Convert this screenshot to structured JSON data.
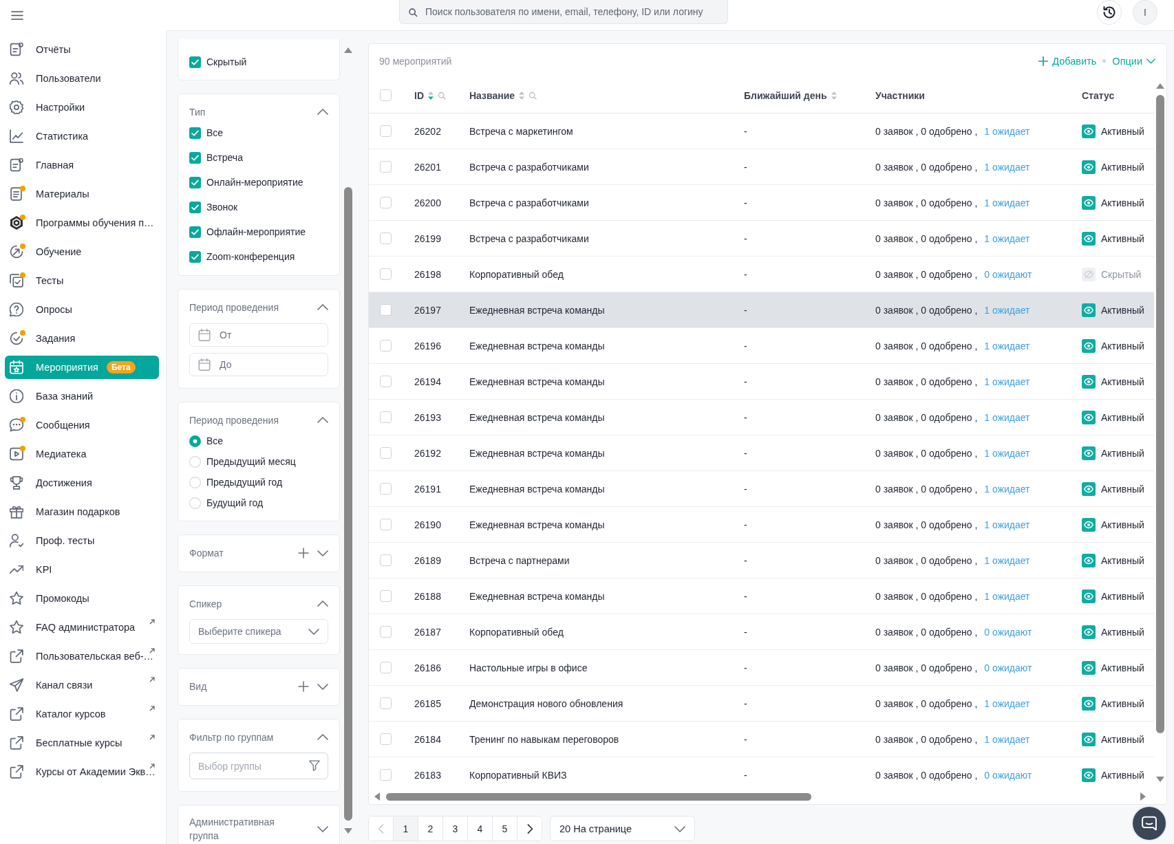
{
  "topbar": {
    "search_placeholder": "Поиск пользователя по имени, email, телефону, ID или логину",
    "avatar": "I"
  },
  "sidebar": {
    "items": [
      {
        "label": "Отчёты",
        "selected": false,
        "notification": false,
        "external": false
      },
      {
        "label": "Пользователи",
        "selected": false,
        "notification": false,
        "external": false
      },
      {
        "label": "Настройки",
        "selected": false,
        "notification": false,
        "external": false
      },
      {
        "label": "Статистика",
        "selected": false,
        "notification": false,
        "external": false
      },
      {
        "label": "Главная",
        "selected": false,
        "notification": false,
        "external": false
      },
      {
        "label": "Материалы",
        "selected": false,
        "notification": true,
        "external": false
      },
      {
        "label": "Программы обучения п…",
        "selected": false,
        "notification": true,
        "external": false
      },
      {
        "label": "Обучение",
        "selected": false,
        "notification": true,
        "external": false
      },
      {
        "label": "Тесты",
        "selected": false,
        "notification": true,
        "external": false
      },
      {
        "label": "Опросы",
        "selected": false,
        "notification": false,
        "external": false
      },
      {
        "label": "Задания",
        "selected": false,
        "notification": true,
        "external": false
      },
      {
        "label": "Мероприятия",
        "selected": true,
        "notification": false,
        "external": false,
        "badge": "Бета"
      },
      {
        "label": "База знаний",
        "selected": false,
        "notification": false,
        "external": false
      },
      {
        "label": "Сообщения",
        "selected": false,
        "notification": true,
        "external": false
      },
      {
        "label": "Медиатека",
        "selected": false,
        "notification": true,
        "external": false
      },
      {
        "label": "Достижения",
        "selected": false,
        "notification": false,
        "external": false
      },
      {
        "label": "Магазин подарков",
        "selected": false,
        "notification": false,
        "external": false
      },
      {
        "label": "Проф. тесты",
        "selected": false,
        "notification": false,
        "external": false
      },
      {
        "label": "KPI",
        "selected": false,
        "notification": false,
        "external": false
      },
      {
        "label": "Промокоды",
        "selected": false,
        "notification": false,
        "external": false
      },
      {
        "label": "FAQ администратора",
        "selected": false,
        "notification": false,
        "external": true
      },
      {
        "label": "Пользовательская веб-…",
        "selected": false,
        "notification": false,
        "external": true
      },
      {
        "label": "Канал связи",
        "selected": false,
        "notification": false,
        "external": true
      },
      {
        "label": "Каталог курсов",
        "selected": false,
        "notification": false,
        "external": true
      },
      {
        "label": "Бесплатные курсы",
        "selected": false,
        "notification": false,
        "external": true
      },
      {
        "label": "Курсы от Академии Экв…",
        "selected": false,
        "notification": false,
        "external": true
      }
    ]
  },
  "filters": {
    "sections": [
      {
        "kind": "checkboxes",
        "items": [
          {
            "label": "Скрытый",
            "checked": true
          }
        ]
      },
      {
        "kind": "checkboxes",
        "title": "Тип",
        "expanded": true,
        "addable": false,
        "items": [
          {
            "label": "Все",
            "checked": true
          },
          {
            "label": "Встреча",
            "checked": true
          },
          {
            "label": "Онлайн-мероприятие",
            "checked": true
          },
          {
            "label": "Звонок",
            "checked": true
          },
          {
            "label": "Офлайн-мероприятие",
            "checked": true
          },
          {
            "label": "Zoom-конференция",
            "checked": true
          }
        ]
      },
      {
        "kind": "dates",
        "title": "Период проведения",
        "expanded": true,
        "addable": false,
        "fields": [
          {
            "placeholder": "От"
          },
          {
            "placeholder": "До"
          }
        ]
      },
      {
        "kind": "radios",
        "title": "Период проведения",
        "expanded": true,
        "addable": false,
        "options": [
          {
            "label": "Все",
            "selected": true
          },
          {
            "label": "Предыдущий месяц",
            "selected": false
          },
          {
            "label": "Предыдущий год",
            "selected": false
          },
          {
            "label": "Будущий год",
            "selected": false
          }
        ]
      },
      {
        "title": "Формат",
        "expanded": false,
        "addable": true
      },
      {
        "kind": "select",
        "title": "Спикер",
        "expanded": true,
        "addable": false,
        "placeholder": "Выберите спикера"
      },
      {
        "title": "Вид",
        "expanded": false,
        "addable": true
      },
      {
        "kind": "search",
        "title": "Фильтр по группам",
        "expanded": true,
        "addable": false,
        "placeholder": "Выбор группы"
      },
      {
        "title": "Административная группа",
        "expanded": false,
        "addable": false
      }
    ]
  },
  "events": {
    "count": "90 мероприятий",
    "add": "Добавить",
    "options": "Опции",
    "select_all_checked": false,
    "columns": [
      {
        "label": "ID",
        "sortable": true,
        "sorted_descending": true,
        "searchable": true
      },
      {
        "label": "Название",
        "sortable": true,
        "sorted_descending": false,
        "searchable": true
      },
      {
        "label": "Ближайший день",
        "sortable": true,
        "sorted_descending": false,
        "searchable": false
      },
      {
        "label": "Участники",
        "sortable": false,
        "searchable": false
      },
      {
        "label": "Статус",
        "sortable": false,
        "searchable": false
      }
    ],
    "rows": [
      {
        "checked": false,
        "highlighted": false,
        "id": "26202",
        "name": "Встреча с маркетингом",
        "next_day": "-",
        "requests": "0 заявок , 0 одобрено ,",
        "pending": "1 ожидает",
        "status": "Активный",
        "visible": true
      },
      {
        "checked": false,
        "highlighted": false,
        "id": "26201",
        "name": "Встреча с разработчиками",
        "next_day": "-",
        "requests": "0 заявок , 0 одобрено ,",
        "pending": "1 ожидает",
        "status": "Активный",
        "visible": true
      },
      {
        "checked": false,
        "highlighted": false,
        "id": "26200",
        "name": "Встреча с разработчиками",
        "next_day": "-",
        "requests": "0 заявок , 0 одобрено ,",
        "pending": "1 ожидает",
        "status": "Активный",
        "visible": true
      },
      {
        "checked": false,
        "highlighted": false,
        "id": "26199",
        "name": "Встреча с разработчиками",
        "next_day": "-",
        "requests": "0 заявок , 0 одобрено ,",
        "pending": "1 ожидает",
        "status": "Активный",
        "visible": true
      },
      {
        "checked": false,
        "highlighted": false,
        "id": "26198",
        "name": "Корпоративный обед",
        "next_day": "-",
        "requests": "0 заявок , 0 одобрено ,",
        "pending": "0 ожидают",
        "status": "Скрытый",
        "visible": false
      },
      {
        "checked": false,
        "highlighted": true,
        "id": "26197",
        "name": "Ежедневная встреча команды",
        "next_day": "-",
        "requests": "0 заявок , 0 одобрено ,",
        "pending": "1 ожидает",
        "status": "Активный",
        "visible": true
      },
      {
        "checked": false,
        "highlighted": false,
        "id": "26196",
        "name": "Ежедневная встреча команды",
        "next_day": "-",
        "requests": "0 заявок , 0 одобрено ,",
        "pending": "1 ожидает",
        "status": "Активный",
        "visible": true
      },
      {
        "checked": false,
        "highlighted": false,
        "id": "26194",
        "name": "Ежедневная встреча команды",
        "next_day": "-",
        "requests": "0 заявок , 0 одобрено ,",
        "pending": "1 ожидает",
        "status": "Активный",
        "visible": true
      },
      {
        "checked": false,
        "highlighted": false,
        "id": "26193",
        "name": "Ежедневная встреча команды",
        "next_day": "-",
        "requests": "0 заявок , 0 одобрено ,",
        "pending": "1 ожидает",
        "status": "Активный",
        "visible": true
      },
      {
        "checked": false,
        "highlighted": false,
        "id": "26192",
        "name": "Ежедневная встреча команды",
        "next_day": "-",
        "requests": "0 заявок , 0 одобрено ,",
        "pending": "1 ожидает",
        "status": "Активный",
        "visible": true
      },
      {
        "checked": false,
        "highlighted": false,
        "id": "26191",
        "name": "Ежедневная встреча команды",
        "next_day": "-",
        "requests": "0 заявок , 0 одобрено ,",
        "pending": "1 ожидает",
        "status": "Активный",
        "visible": true
      },
      {
        "checked": false,
        "highlighted": false,
        "id": "26190",
        "name": "Ежедневная встреча команды",
        "next_day": "-",
        "requests": "0 заявок , 0 одобрено ,",
        "pending": "1 ожидает",
        "status": "Активный",
        "visible": true
      },
      {
        "checked": false,
        "highlighted": false,
        "id": "26189",
        "name": "Встреча с партнерами",
        "next_day": "-",
        "requests": "0 заявок , 0 одобрено ,",
        "pending": "1 ожидает",
        "status": "Активный",
        "visible": true
      },
      {
        "checked": false,
        "highlighted": false,
        "id": "26188",
        "name": "Ежедневная встреча команды",
        "next_day": "-",
        "requests": "0 заявок , 0 одобрено ,",
        "pending": "1 ожидает",
        "status": "Активный",
        "visible": true
      },
      {
        "checked": false,
        "highlighted": false,
        "id": "26187",
        "name": "Корпоративный обед",
        "next_day": "-",
        "requests": "0 заявок , 0 одобрено ,",
        "pending": "0 ожидают",
        "status": "Активный",
        "visible": true
      },
      {
        "checked": false,
        "highlighted": false,
        "id": "26186",
        "name": "Настольные игры в офисе",
        "next_day": "-",
        "requests": "0 заявок , 0 одобрено ,",
        "pending": "0 ожидают",
        "status": "Активный",
        "visible": true
      },
      {
        "checked": false,
        "highlighted": false,
        "id": "26185",
        "name": "Демонстрация нового обновления",
        "next_day": "-",
        "requests": "0 заявок , 0 одобрено ,",
        "pending": "1 ожидает",
        "status": "Активный",
        "visible": true
      },
      {
        "checked": false,
        "highlighted": false,
        "id": "26184",
        "name": "Тренинг по навыкам переговоров",
        "next_day": "-",
        "requests": "0 заявок , 0 одобрено ,",
        "pending": "1 ожидает",
        "status": "Активный",
        "visible": true
      },
      {
        "checked": false,
        "highlighted": false,
        "id": "26183",
        "name": "Корпоративный КВИЗ",
        "next_day": "-",
        "requests": "0 заявок , 0 одобрено ,",
        "pending": "0 ожидают",
        "status": "Активный",
        "visible": true
      }
    ]
  },
  "pagination": {
    "prev_disabled": true,
    "next_disabled": false,
    "pages": [
      {
        "label": "1",
        "selected": true
      },
      {
        "label": "2",
        "selected": false
      },
      {
        "label": "3",
        "selected": false
      },
      {
        "label": "4",
        "selected": false
      },
      {
        "label": "5",
        "selected": false
      }
    ],
    "page_size": "20 На странице"
  }
}
